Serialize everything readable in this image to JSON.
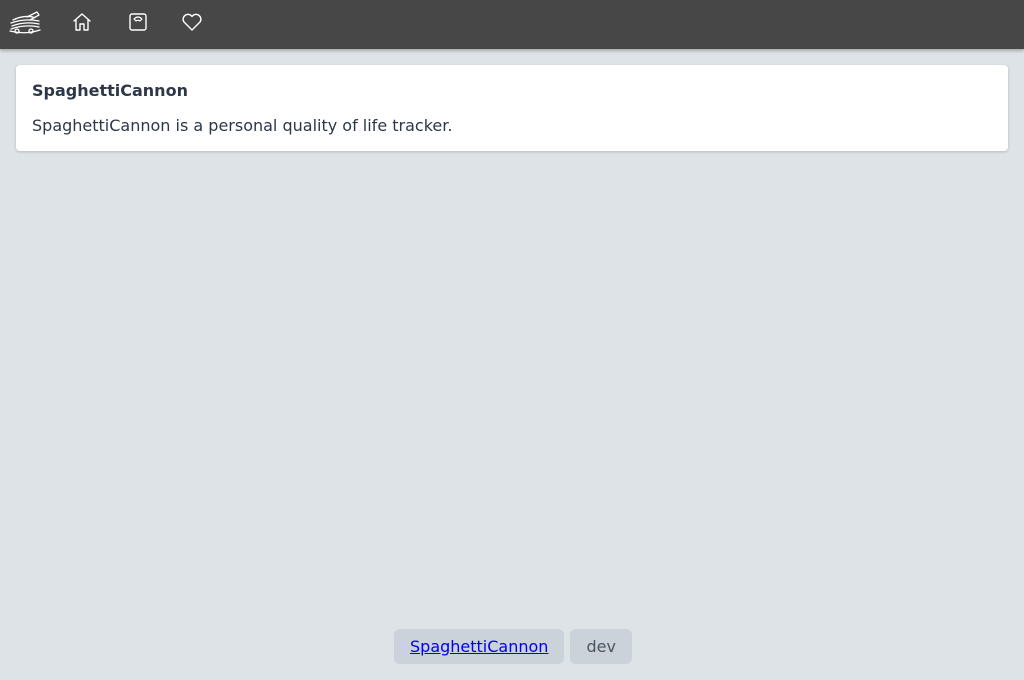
{
  "nav": {
    "items": [
      {
        "icon": "spaghetti-cannon-logo-icon"
      },
      {
        "icon": "home-icon"
      },
      {
        "icon": "scale-icon"
      },
      {
        "icon": "heart-icon"
      }
    ]
  },
  "card": {
    "title": "SpaghettiCannon",
    "description": "SpaghettiCannon is a personal quality of life tracker."
  },
  "footer": {
    "app_link": "SpaghettiCannon",
    "env_label": "dev"
  },
  "colors": {
    "topbar": "#474747",
    "background": "#dee3e7",
    "card": "#ffffff",
    "pill": "#cbd2d9",
    "link": "#0000ee"
  }
}
